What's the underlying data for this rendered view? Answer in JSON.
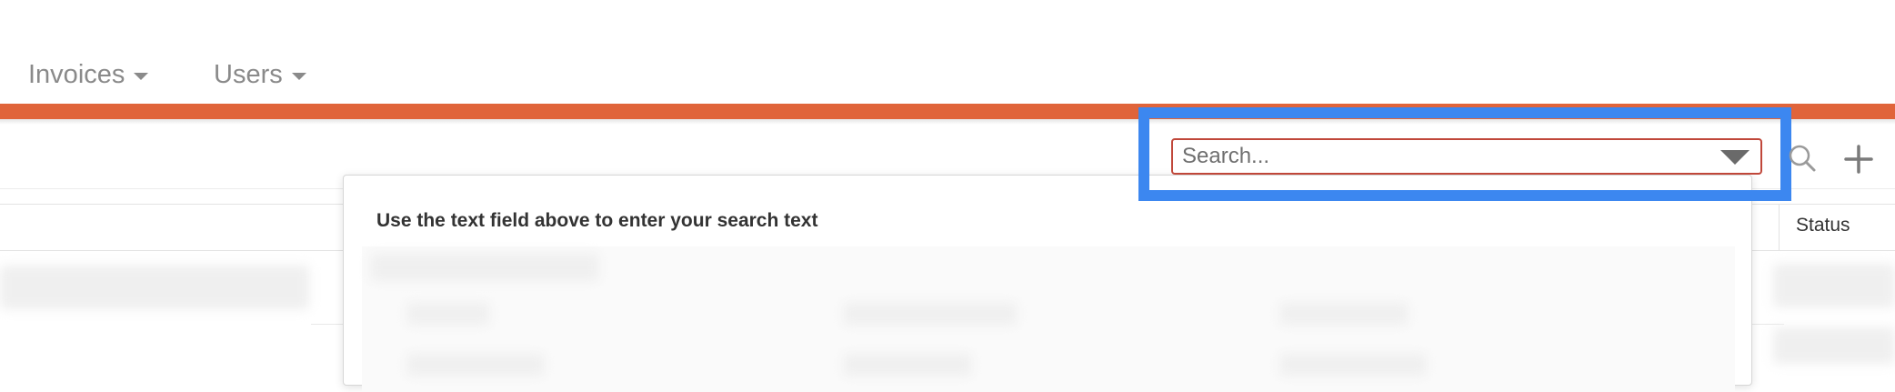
{
  "nav": {
    "items": [
      {
        "label": "Invoices"
      },
      {
        "label": "Users"
      }
    ]
  },
  "toolbar": {
    "search": {
      "placeholder": "Search...",
      "value": ""
    }
  },
  "popover": {
    "hint": "Use the text field above to enter your search text"
  },
  "table": {
    "columns": [
      {
        "label": "Status"
      }
    ]
  },
  "colors": {
    "accent_bar": "#e0643a",
    "highlight": "#3c87f0",
    "search_border": "#c0473a"
  },
  "icons": [
    "chevron-down-icon",
    "search-icon",
    "plus-icon"
  ]
}
